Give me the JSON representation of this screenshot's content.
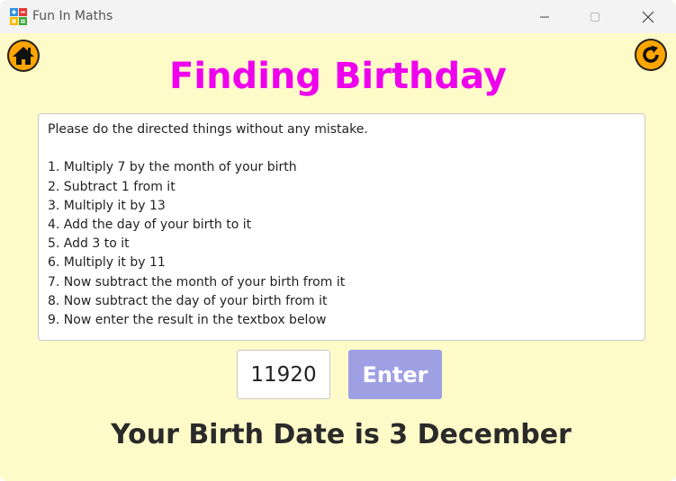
{
  "window": {
    "title": "Fun In Maths"
  },
  "colors": {
    "background": "#FFFBC9",
    "heading": "#EE00EE",
    "round_button": "#FFA500",
    "enter_button": "#9FA0E4"
  },
  "toolbar": {
    "home_icon": "home-icon",
    "refresh_icon": "refresh-icon"
  },
  "main": {
    "heading": "Finding Birthday",
    "instructions": [
      "Please do the directed things without any mistake.",
      "",
      "1. Multiply 7 by the month of your birth",
      "2. Subtract 1 from it",
      "3. Multiply it by 13",
      "4. Add the day of your birth to it",
      "5. Add 3 to it",
      "6. Multiply it by 11",
      "7. Now subtract the month of your birth from it",
      "8. Now subtract the day of your birth from it",
      "9. Now enter the result in the textbox below"
    ],
    "input_value": "11920",
    "enter_label": "Enter",
    "result": "Your Birth Date is 3 December"
  }
}
